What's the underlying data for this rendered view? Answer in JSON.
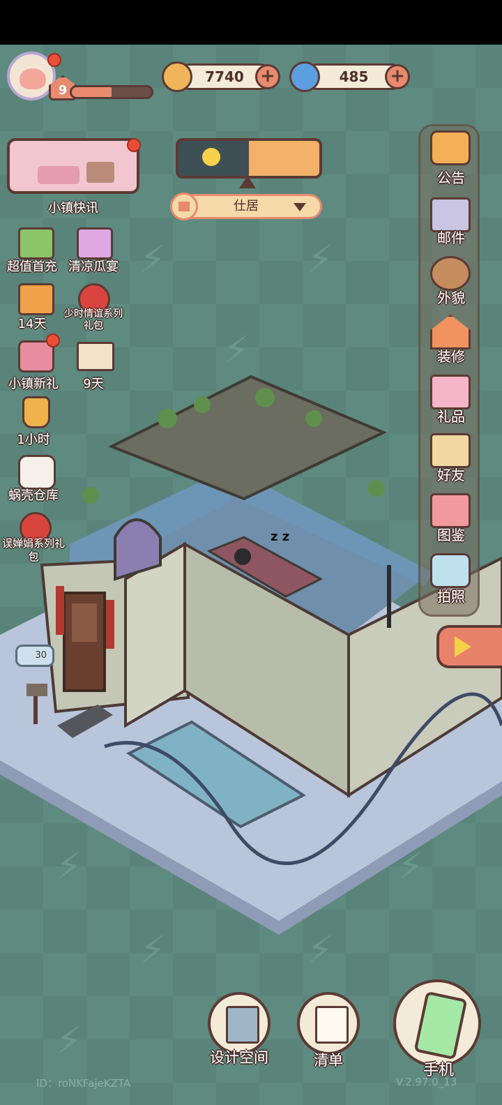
{
  "player": {
    "level": "9",
    "exp_fraction": 0.5
  },
  "currency": {
    "coins": "7740",
    "gems": "485"
  },
  "news": {
    "label": "小镇快讯"
  },
  "room": {
    "name": "仕居"
  },
  "left_events": [
    {
      "label": "超值首充"
    },
    {
      "label": "清凉瓜宴"
    },
    {
      "label": "14天"
    },
    {
      "label": "少时情谊系列礼包"
    },
    {
      "label": "小镇新礼"
    },
    {
      "label": "9天"
    },
    {
      "label": "1小时"
    },
    {
      "label": "蜗壳仓库"
    },
    {
      "label": "误婵娟系列礼包"
    }
  ],
  "right_menu": [
    {
      "label": "公告"
    },
    {
      "label": "邮件"
    },
    {
      "label": "外貌"
    },
    {
      "label": "装修"
    },
    {
      "label": "礼品"
    },
    {
      "label": "好友"
    },
    {
      "label": "图鉴"
    },
    {
      "label": "拍照"
    }
  ],
  "mailbox": {
    "count": "30"
  },
  "bottom": {
    "design": "设计空间",
    "list": "清单",
    "phone": "手机"
  },
  "footer": {
    "id": "ID：roNKFajeKZTA",
    "version": "V.2.97.0_13"
  },
  "colors": {
    "outline": "#5b3a34",
    "accent": "#e88a6d",
    "red_dot": "#e84f3a"
  }
}
